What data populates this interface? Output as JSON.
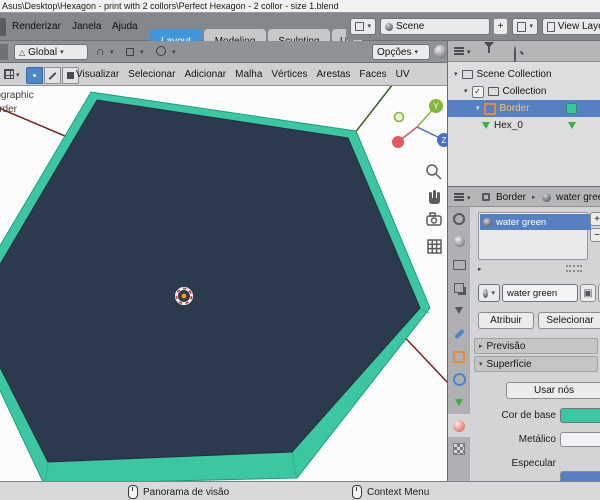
{
  "window": {
    "title": "Asus\\Desktop\\Hexagon - print with 2 collors\\Perfect Hexagon - 2 collor - size 1.blend"
  },
  "menubar": {
    "menus": [
      "Renderizar",
      "Janela",
      "Ajuda"
    ],
    "tabs": [
      {
        "label": "Layout",
        "active": true
      },
      {
        "label": "Modeling",
        "active": false
      },
      {
        "label": "Sculpting",
        "active": false
      },
      {
        "label": "UV",
        "active": false
      }
    ]
  },
  "scene_bar": {
    "scene": "Scene",
    "view_layer": "View Layer"
  },
  "tools": {
    "orientation": "Global",
    "options": "Opções"
  },
  "view_header": {
    "menus": [
      "Visualizar",
      "Selecionar",
      "Adicionar",
      "Malha",
      "Vértices",
      "Arestas",
      "Faces",
      "UV"
    ]
  },
  "viewport": {
    "overlay": [
      "User Orthographic",
      "Border"
    ],
    "gizmo": {
      "y": "Y",
      "z": "Z"
    },
    "colors": {
      "top": "#2b3a4d",
      "side": "#3cc6a2",
      "side_edge": "#1f9d80",
      "axis_red": "#7b1d1d",
      "axis_green": "#3f5a23",
      "cursor_red": "#d94038",
      "origin_orange": "#ff9d1e"
    }
  },
  "outliner": {
    "rows": [
      {
        "name": "Scene Collection"
      },
      {
        "name": "Collection"
      },
      {
        "name": "Border"
      },
      {
        "name": "Hex_0"
      }
    ]
  },
  "props": {
    "breadcrumb_object": "Border",
    "breadcrumb_material": "water green",
    "slot_name": "water green",
    "material_name": "water green",
    "assign_label": "Atribuir",
    "select_label": "Selecionar",
    "preview_label": "Previsão",
    "surface_label": "Superfície",
    "use_nodes_label": "Usar nós",
    "base_color_label": "Cor de base",
    "base_color": "#3cc6a2",
    "metallic_label": "Metálico",
    "specular_label": "Especular",
    "accent": "#5680c2"
  },
  "status": {
    "left": "Panorama de visão",
    "right": "Context Menu"
  }
}
